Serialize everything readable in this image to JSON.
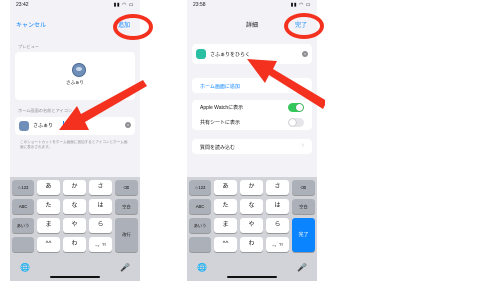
{
  "left": {
    "status": {
      "time": "23:42",
      "icons": "▮▮ ◠ ▭"
    },
    "nav": {
      "cancel": "キャンセル",
      "add": "追加"
    },
    "preview": {
      "section_label": "プレビュー",
      "label": "さふぁり"
    },
    "home_name": {
      "section_label": "ホーム画面の名前とアイコン",
      "value": "さふぁり",
      "clear": "×"
    },
    "hint": "このショートカットをホーム画面に追加するとアイコンとホーム画面に表示されます。",
    "keyboard": {
      "rows": [
        [
          "☆123",
          "あ",
          "か",
          "さ",
          "⌫"
        ],
        [
          "ABC",
          "た",
          "な",
          "は",
          "空白"
        ],
        [
          "あいう",
          "ま",
          "や",
          "ら",
          "改行"
        ],
        [
          "",
          "^^",
          "わ",
          "、。?!",
          ""
        ]
      ],
      "globe": "🌐",
      "mic": "🎤"
    }
  },
  "right": {
    "status": {
      "time": "23:58",
      "icons": "▮▮ ◠ ▭"
    },
    "nav": {
      "title": "詳細",
      "done": "完了"
    },
    "shortcut": {
      "name": "さふぁりをひらく",
      "clear": "×"
    },
    "add_home": "ホーム画面に追加",
    "toggles": [
      {
        "label": "Apple Watchに表示",
        "on": true
      },
      {
        "label": "共有シートに表示",
        "on": false
      }
    ],
    "import_questions": "質問を読み込む",
    "chevron": "›",
    "keyboard": {
      "rows": [
        [
          "☆123",
          "あ",
          "か",
          "さ",
          "⌫"
        ],
        [
          "ABC",
          "た",
          "な",
          "は",
          "空白"
        ],
        [
          "あいう",
          "ま",
          "や",
          "ら",
          "完了"
        ],
        [
          "",
          "^^",
          "わ",
          "、。?!",
          ""
        ]
      ],
      "globe": "🌐",
      "mic": "🎤"
    }
  },
  "colors": {
    "accent": "#0a84ff",
    "highlight": "#f4311e",
    "toggle_on": "#34c759",
    "toggle_off": "#e5e5ea"
  }
}
